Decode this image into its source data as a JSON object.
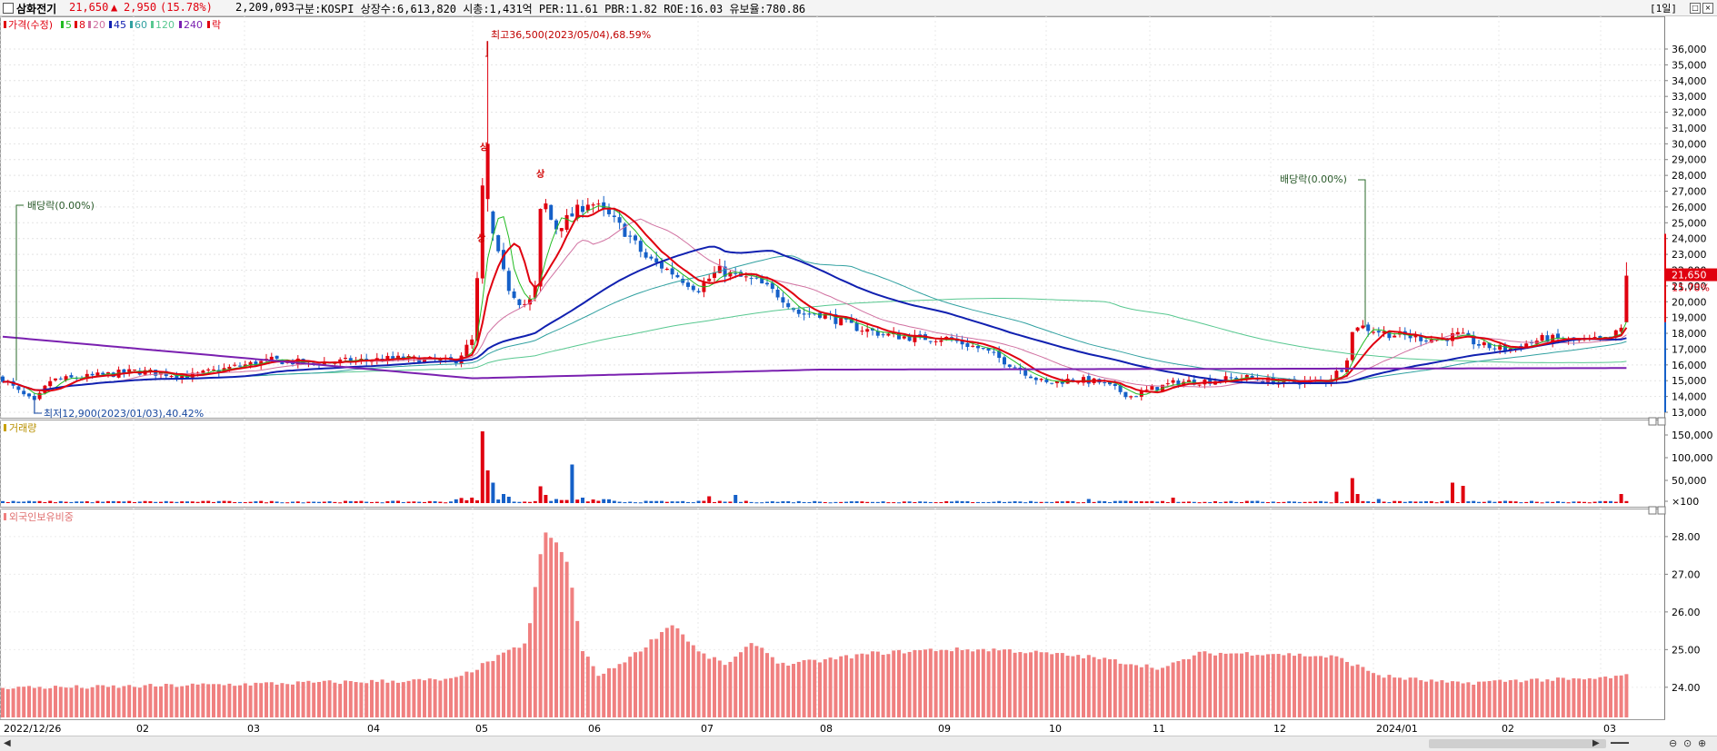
{
  "header": {
    "name": "삼화전기",
    "price": "21,650",
    "change_arrow": "▲",
    "change": "2,950",
    "change_pct": "(15.78%)",
    "volume": "2,209,093",
    "info": "구분:KOSPI  상장수:6,613,820  시총:1,431억  PER:11.61  PBR:1.82  ROE:16.03  유보율:780.86",
    "period": "[1일]"
  },
  "colors": {
    "up": "#e0000f",
    "down": "#1560c8",
    "ma5": "#22bb22",
    "ma8": "#e0000f",
    "ma20": "#d070a0",
    "ma45": "#1020b0",
    "ma60": "#30a0a0",
    "ma120": "#58c890",
    "ma240": "#7a20b0",
    "foreign": "#f08080"
  },
  "chart_data": [
    {
      "type": "candlestick",
      "legend": [
        "가격(수정)",
        "5",
        "8",
        "20",
        "45",
        "60",
        "120",
        "240",
        "락"
      ],
      "ylim": [
        12500,
        37300
      ],
      "y_ticks": [
        "13,000",
        "14,000",
        "15,000",
        "16,000",
        "17,000",
        "18,000",
        "19,000",
        "20,000",
        "21,000",
        "22,000",
        "23,000",
        "24,000",
        "25,000",
        "26,000",
        "27,000",
        "28,000",
        "29,000",
        "30,000",
        "31,000",
        "32,000",
        "33,000",
        "34,000",
        "35,000",
        "36,000"
      ],
      "x_labels": [
        "2022/12/26",
        "02",
        "03",
        "04",
        "05",
        "06",
        "07",
        "08",
        "09",
        "10",
        "11",
        "12",
        "2024/01",
        "02",
        "03"
      ],
      "price_tags": [
        "21,650",
        "15.78%"
      ],
      "annotations": {
        "high": "최고36,500(2023/05/04),68.59%",
        "low": "최저12,900(2023/01/03),40.42%",
        "ex_div_1": "배당락(0.00%)",
        "ex_div_2": "배당락(0.00%)",
        "limit_up": "상"
      },
      "ma_240_start": 17800,
      "key_points": [
        {
          "date": "2023-05-04",
          "high": 36500
        },
        {
          "date": "2023-01-03",
          "low": 12900
        },
        {
          "date": "2024-03-05",
          "close": 21650
        }
      ]
    },
    {
      "type": "bar",
      "legend": [
        "거래량"
      ],
      "y_ticks": [
        "150,000",
        "100,000",
        "50,000",
        "×100"
      ],
      "note": "volume in 100-share units"
    },
    {
      "type": "bar",
      "legend": [
        "외국인보유비중"
      ],
      "ylim": [
        23.2,
        28.6
      ],
      "y_ticks": [
        "28.00",
        "27.00",
        "26.00",
        "25.00",
        "24.00"
      ]
    }
  ]
}
